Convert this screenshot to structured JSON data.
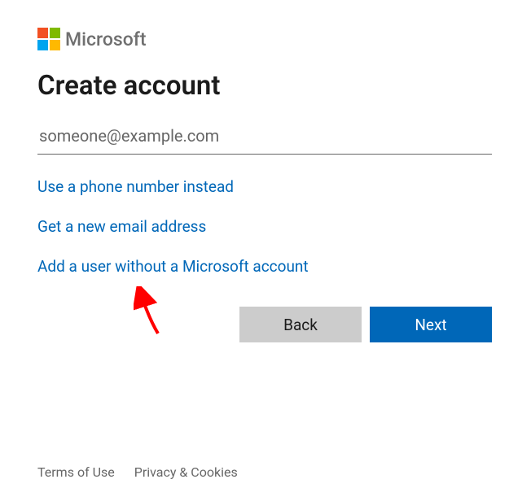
{
  "brand": "Microsoft",
  "heading": "Create account",
  "email": {
    "placeholder": "someone@example.com",
    "value": ""
  },
  "links": {
    "phone": "Use a phone number instead",
    "new_email": "Get a new email address",
    "no_account": "Add a user without a Microsoft account"
  },
  "buttons": {
    "back": "Back",
    "next": "Next"
  },
  "footer": {
    "terms": "Terms of Use",
    "privacy": "Privacy & Cookies"
  },
  "colors": {
    "primary": "#0067b8",
    "link": "#0067b8",
    "arrow": "#ff0000"
  }
}
